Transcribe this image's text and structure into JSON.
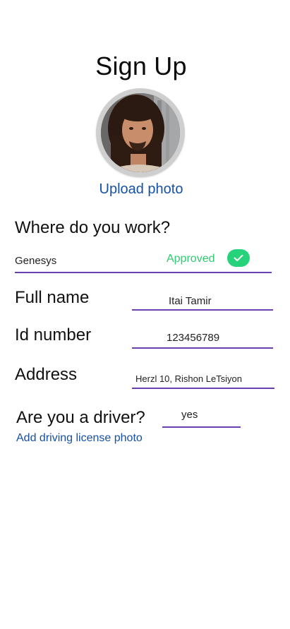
{
  "header": {
    "title": "Sign Up"
  },
  "profile": {
    "upload_label": "Upload photo"
  },
  "work": {
    "question": "Where do you work?",
    "value": "Genesys",
    "status": "Approved"
  },
  "fields": {
    "full_name_label": "Full name",
    "full_name_value": "Itai Tamir",
    "id_label": "Id number",
    "id_value": "123456789",
    "address_label": "Address",
    "address_value": "Herzl 10, Rishon LeTsiyon"
  },
  "driver": {
    "question": "Are you a driver?",
    "value": "yes",
    "license_link": "Add driving license photo"
  },
  "colors": {
    "accent_line": "#6a3fb0",
    "link": "#1650a8",
    "approved": "#2ecc71"
  }
}
